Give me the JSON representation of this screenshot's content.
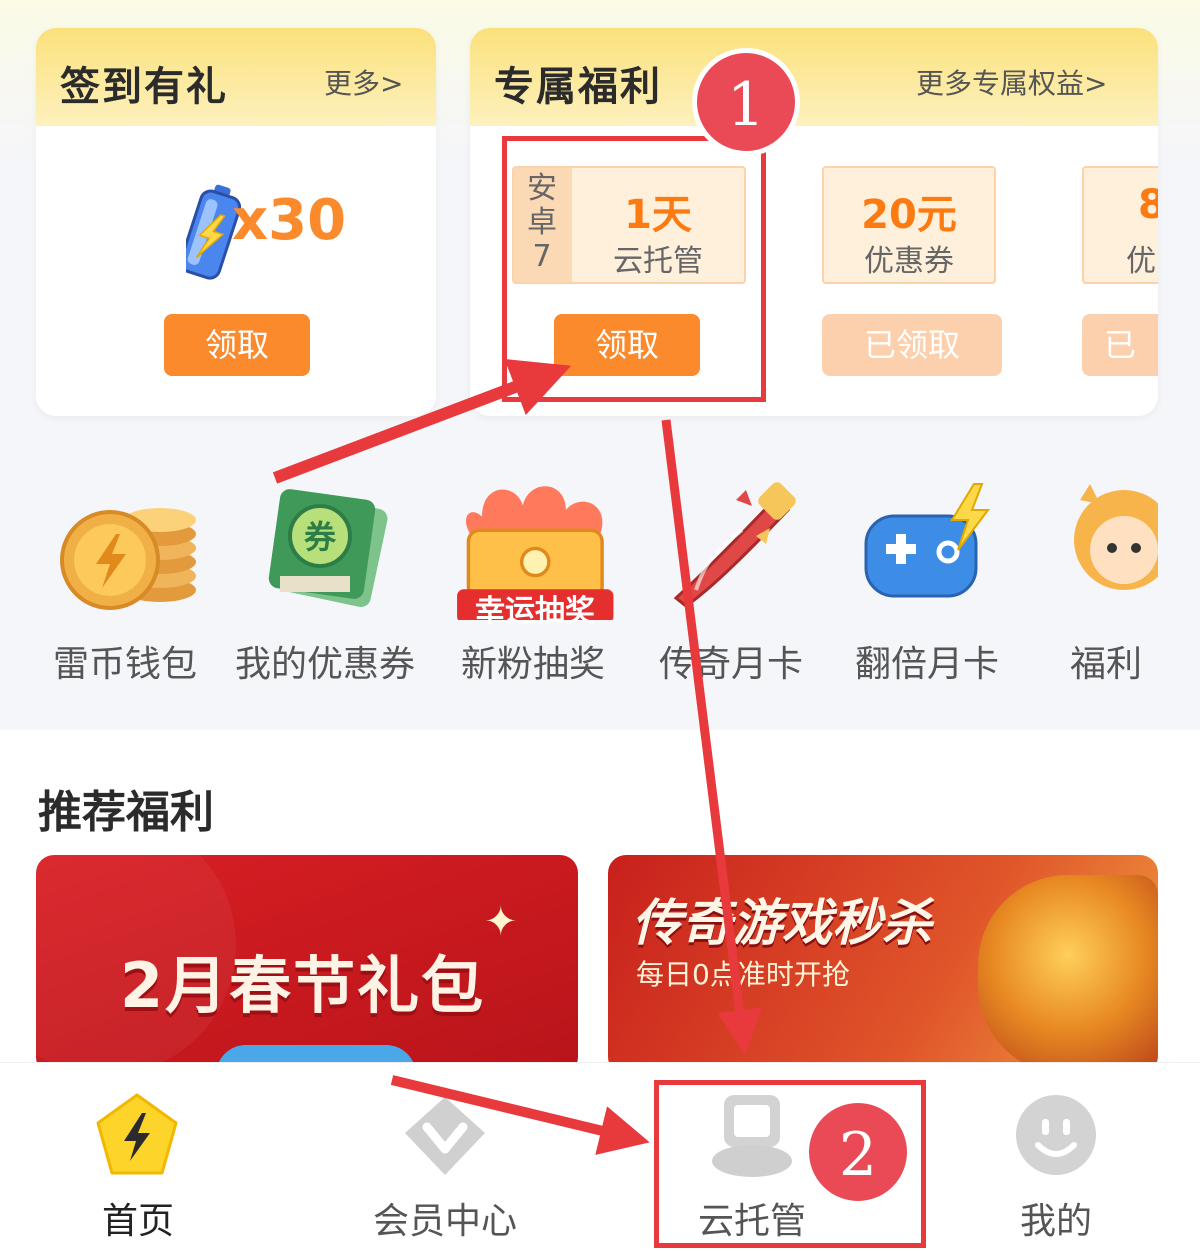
{
  "signin_card": {
    "title": "签到有礼",
    "more": "更多>",
    "reward_count": "x30",
    "claim_label": "领取"
  },
  "exclusive_card": {
    "title": "专属福利",
    "more": "更多专属权益>",
    "coupons": [
      {
        "side": "安卓7",
        "value": "1天",
        "desc": "云托管",
        "button": "领取",
        "state": "active"
      },
      {
        "value": "20元",
        "desc": "优惠券",
        "button": "已领取",
        "state": "claimed"
      },
      {
        "value": "8",
        "desc": "优",
        "button": "已",
        "state": "claimed"
      }
    ]
  },
  "quick_entries": [
    {
      "label": "雷币钱包",
      "icon": "coin-stack-icon"
    },
    {
      "label": "我的优惠券",
      "icon": "voucher-icon",
      "icon_text": "券"
    },
    {
      "label": "新粉抽奖",
      "icon": "lucky-draw-icon",
      "icon_text": "幸运抽奖"
    },
    {
      "label": "传奇月卡",
      "icon": "sword-icon"
    },
    {
      "label": "翻倍月卡",
      "icon": "gamepad-icon"
    },
    {
      "label": "福利",
      "icon": "character-icon"
    }
  ],
  "recommended": {
    "title": "推荐福利",
    "banners": [
      {
        "title": "2月春节礼包"
      },
      {
        "title": "传奇游戏秒杀",
        "subtitle": "每日0点准时开抢"
      }
    ]
  },
  "bottom_nav": [
    {
      "label": "首页",
      "icon": "lightning-home-icon",
      "active": true
    },
    {
      "label": "会员中心",
      "icon": "diamond-v-icon",
      "active": false
    },
    {
      "label": "云托管",
      "icon": "cloud-host-icon",
      "active": false
    },
    {
      "label": "我的",
      "icon": "smiley-icon",
      "active": false
    }
  ],
  "annotations": {
    "step1": "1",
    "step2": "2"
  },
  "colors": {
    "accent": "#fb8a2c",
    "annotation": "#e8393c",
    "header_yellow": "#fbe17c"
  }
}
